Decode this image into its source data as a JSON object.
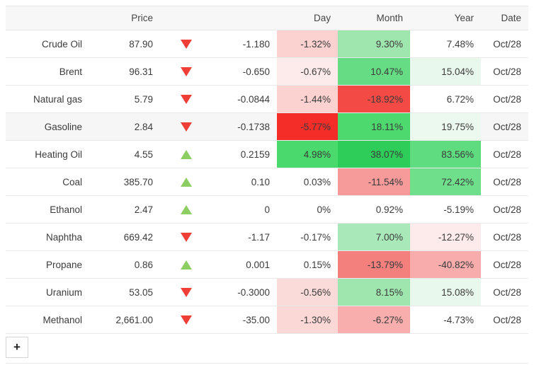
{
  "table": {
    "columns": [
      {
        "key": "name",
        "label": "",
        "align": "left"
      },
      {
        "key": "price",
        "label": "Price",
        "align": "right"
      },
      {
        "key": "arrow",
        "label": "",
        "align": "center"
      },
      {
        "key": "change",
        "label": "",
        "align": "right"
      },
      {
        "key": "day",
        "label": "Day",
        "align": "right"
      },
      {
        "key": "month",
        "label": "Month",
        "align": "right"
      },
      {
        "key": "year",
        "label": "Year",
        "align": "right"
      },
      {
        "key": "date",
        "label": "Date",
        "align": "right"
      }
    ],
    "header": {
      "name": "",
      "price": "Price",
      "arrow": "",
      "change": "",
      "day": "Day",
      "month": "Month",
      "year": "Year",
      "date": "Date"
    },
    "rows": [
      {
        "name": "Crude Oil",
        "price": "87.90",
        "direction": "down",
        "arrow_icon": "triangle-down-icon",
        "change": "-1.180",
        "day": "-1.32%",
        "day_bg": "#fbd2d0",
        "month": "9.30%",
        "month_bg": "#9fe5ae",
        "year": "7.48%",
        "year_bg": "transparent",
        "date": "Oct/28",
        "highlight": false
      },
      {
        "name": "Brent",
        "price": "96.31",
        "direction": "down",
        "arrow_icon": "triangle-down-icon",
        "change": "-0.650",
        "day": "-0.67%",
        "day_bg": "#fdeaea",
        "month": "10.47%",
        "month_bg": "#66dd84",
        "year": "15.04%",
        "year_bg": "#e8f8ec",
        "date": "Oct/28",
        "highlight": false
      },
      {
        "name": "Natural gas",
        "price": "5.79",
        "direction": "down",
        "arrow_icon": "triangle-down-icon",
        "change": "-0.0844",
        "day": "-1.44%",
        "day_bg": "#fbd2d0",
        "month": "-18.92%",
        "month_bg": "#f44a45",
        "year": "6.72%",
        "year_bg": "transparent",
        "date": "Oct/28",
        "highlight": false
      },
      {
        "name": "Gasoline",
        "price": "2.84",
        "direction": "down",
        "arrow_icon": "triangle-down-icon",
        "change": "-0.1738",
        "day": "-5.77%",
        "day_bg": "#f42d28",
        "month": "18.11%",
        "month_bg": "#4ed96f",
        "year": "19.75%",
        "year_bg": "#ecf9ef",
        "date": "Oct/28",
        "highlight": true
      },
      {
        "name": "Heating Oil",
        "price": "4.55",
        "direction": "up",
        "arrow_icon": "triangle-up-icon",
        "change": "0.2159",
        "day": "4.98%",
        "day_bg": "#49d96c",
        "month": "38.07%",
        "month_bg": "#2ecc58",
        "year": "83.56%",
        "year_bg": "#5edc7f",
        "date": "Oct/28",
        "highlight": false
      },
      {
        "name": "Coal",
        "price": "385.70",
        "direction": "up",
        "arrow_icon": "triangle-up-icon",
        "change": "0.10",
        "day": "0.03%",
        "day_bg": "transparent",
        "month": "-11.54%",
        "month_bg": "#f69b99",
        "year": "72.42%",
        "year_bg": "#6fdf8c",
        "date": "Oct/28",
        "highlight": false
      },
      {
        "name": "Ethanol",
        "price": "2.47",
        "direction": "up",
        "arrow_icon": "triangle-up-icon",
        "change": "0",
        "day": "0%",
        "day_bg": "transparent",
        "month": "0.92%",
        "month_bg": "transparent",
        "year": "-5.19%",
        "year_bg": "transparent",
        "date": "Oct/28",
        "highlight": false
      },
      {
        "name": "Naphtha",
        "price": "669.42",
        "direction": "down",
        "arrow_icon": "triangle-down-icon",
        "change": "-1.17",
        "day": "-0.17%",
        "day_bg": "transparent",
        "month": "7.00%",
        "month_bg": "#a9e8b8",
        "year": "-12.27%",
        "year_bg": "#fdeaea",
        "date": "Oct/28",
        "highlight": false
      },
      {
        "name": "Propane",
        "price": "0.86",
        "direction": "up",
        "arrow_icon": "triangle-up-icon",
        "change": "0.001",
        "day": "0.15%",
        "day_bg": "transparent",
        "month": "-13.79%",
        "month_bg": "#f4807e",
        "year": "-40.82%",
        "year_bg": "#f8acab",
        "date": "Oct/28",
        "highlight": false
      },
      {
        "name": "Uranium",
        "price": "53.05",
        "direction": "down",
        "arrow_icon": "triangle-down-icon",
        "change": "-0.3000",
        "day": "-0.56%",
        "day_bg": "#fbdbda",
        "month": "8.15%",
        "month_bg": "#9fe5ae",
        "year": "15.08%",
        "year_bg": "#e9f8ed",
        "date": "Oct/28",
        "highlight": false
      },
      {
        "name": "Methanol",
        "price": "2,661.00",
        "direction": "down",
        "arrow_icon": "triangle-down-icon",
        "change": "-35.00",
        "day": "-1.30%",
        "day_bg": "#fbd8d6",
        "month": "-6.27%",
        "month_bg": "#f8aeac",
        "year": "-4.73%",
        "year_bg": "transparent",
        "date": "Oct/28",
        "highlight": false
      }
    ]
  },
  "footer": {
    "add_label": "+",
    "add_icon": "plus-icon"
  },
  "colors": {
    "up_arrow": "#8dce62",
    "down_arrow": "#ef3e36",
    "header_bg": "#f7f7f7",
    "row_highlight": "#f6f6f6",
    "border": "#e9e9e9"
  }
}
